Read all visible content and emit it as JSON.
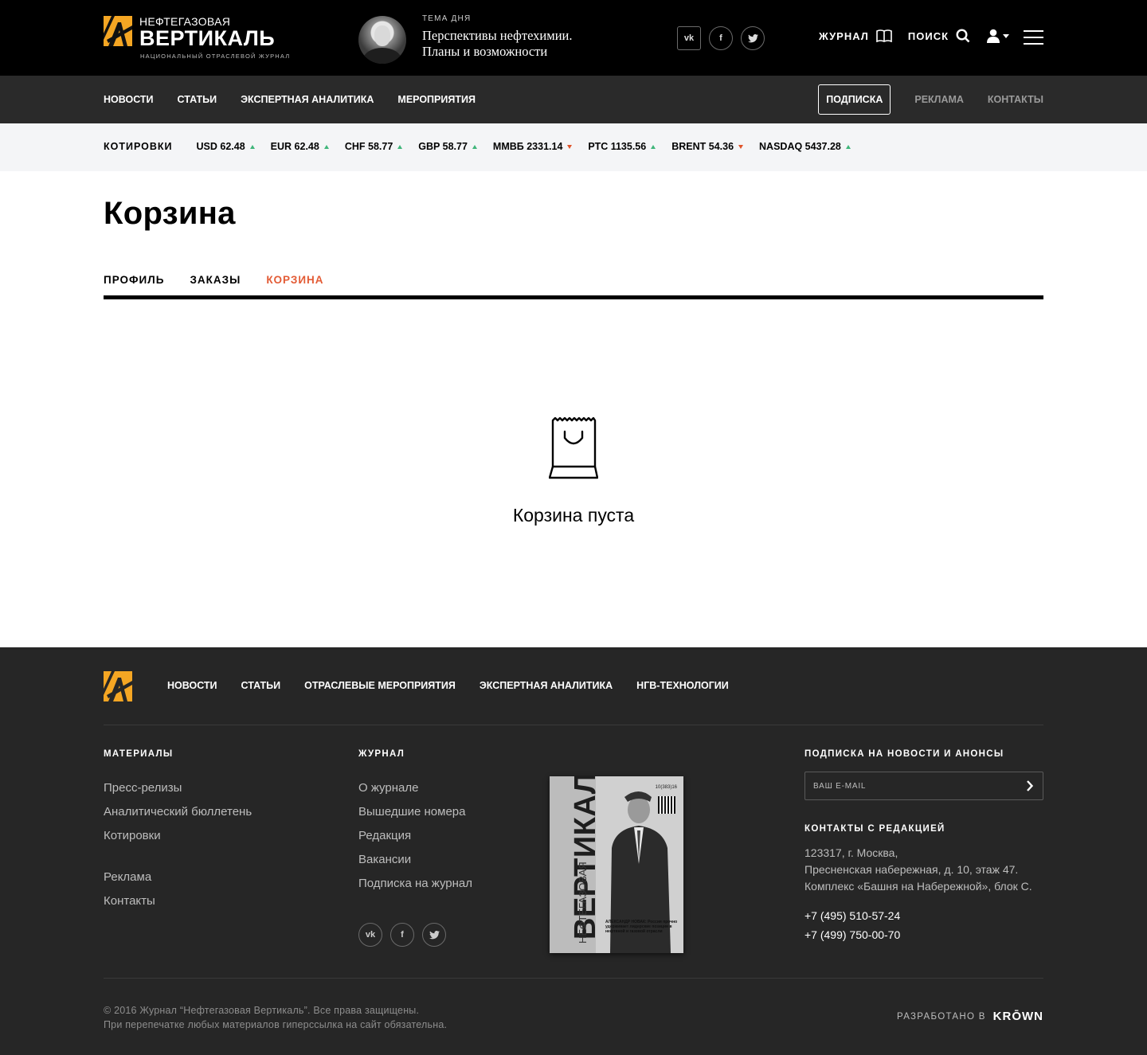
{
  "header": {
    "logo": {
      "line1": "НЕФТЕГАЗОВАЯ",
      "line2": "ВЕРТИКАЛЬ",
      "tagline": "НАЦИОНАЛЬНЫЙ ОТРАСЛЕВОЙ ЖУРНАЛ",
      "accent": "#f5a623"
    },
    "topic_label": "ТЕМА ДНЯ",
    "topic_title_1": "Перспективы нефтехимии.",
    "topic_title_2": "Планы и возможности",
    "social": [
      "vk-icon",
      "facebook-icon",
      "twitter-icon"
    ],
    "journal_label": "ЖУРНАЛ",
    "search_label": "ПОИСК"
  },
  "nav": {
    "items": [
      "НОВОСТИ",
      "СТАТЬИ",
      "ЭКСПЕРТНАЯ АНАЛИТИКА",
      "МЕРОПРИЯТИЯ"
    ],
    "subscribe": "ПОДПИСКА",
    "ads": "РЕКЛАМА",
    "contacts": "КОНТАКТЫ"
  },
  "quotes": {
    "label": "КОТИРОВКИ",
    "items": [
      {
        "text": "USD 62.48",
        "trend": "up"
      },
      {
        "text": "EUR 62.48",
        "trend": "up"
      },
      {
        "text": "CHF 58.77",
        "trend": "up"
      },
      {
        "text": "GBP 58.77",
        "trend": "up"
      },
      {
        "text": "ММВБ 2331.14",
        "trend": "down"
      },
      {
        "text": "РТС 1135.56",
        "trend": "up"
      },
      {
        "text": "BRENT 54.36",
        "trend": "down"
      },
      {
        "text": "NASDAQ 5437.28",
        "trend": "up"
      }
    ],
    "up_color": "#3fb57a",
    "down_color": "#e0542a"
  },
  "main": {
    "title": "Корзина",
    "tabs": [
      "ПРОФИЛЬ",
      "ЗАКАЗЫ",
      "КОРЗИНА"
    ],
    "active_tab": "КОРЗИНА",
    "active_color": "#e35b35",
    "empty_text": "Корзина пуста"
  },
  "footer": {
    "nav": [
      "НОВОСТИ",
      "СТАТЬИ",
      "ОТРАСЛЕВЫЕ МЕРОПРИЯТИЯ",
      "ЭКСПЕРТНАЯ АНАЛИТИКА",
      "НГВ-ТЕХНОЛОГИИ"
    ],
    "materials_head": "МАТЕРИАЛЫ",
    "materials": [
      "Пресс-релизы",
      "Аналитический бюллетень",
      "Котировки"
    ],
    "materials2": [
      "Реклама",
      "Контакты"
    ],
    "journal_head": "ЖУРНАЛ",
    "journal": [
      "О журнале",
      "Вышедшие номера",
      "Редакция",
      "Вакансии",
      "Подписка на журнал"
    ],
    "cover": {
      "title": "ВЕРТИКАЛЬ",
      "subtitle": "НЕФТЕГАЗОВАЯ",
      "issue": "10(383)16",
      "caption": "АЛЕКСАНДР НОВАК: Россия прочно удерживает лидерские позиции в нефтяной и газовой отрасли"
    },
    "subscribe_head": "ПОДПИСКА НА НОВОСТИ И АНОНСЫ",
    "email_placeholder": "ВАШ E-MAIL",
    "contacts_head": "КОНТАКТЫ С РЕДАКЦИЕЙ",
    "address": [
      "123317, г. Москва,",
      "Пресненская набережная, д. 10, этаж 47.",
      "Комплекс «Башня на Набережной», блок С."
    ],
    "phones": [
      "+7 (495) 510-57-24",
      "+7 (499) 750-00-70"
    ],
    "copyright_1": "© 2016 Журнал “Нефтегазовая Вертикаль”. Все права защищены.",
    "copyright_2": "При перепечатке любых материалов гиперссылка на сайт обязательна.",
    "developed_by": "РАЗРАБОТАНО В",
    "developer": "KRŌWN"
  }
}
